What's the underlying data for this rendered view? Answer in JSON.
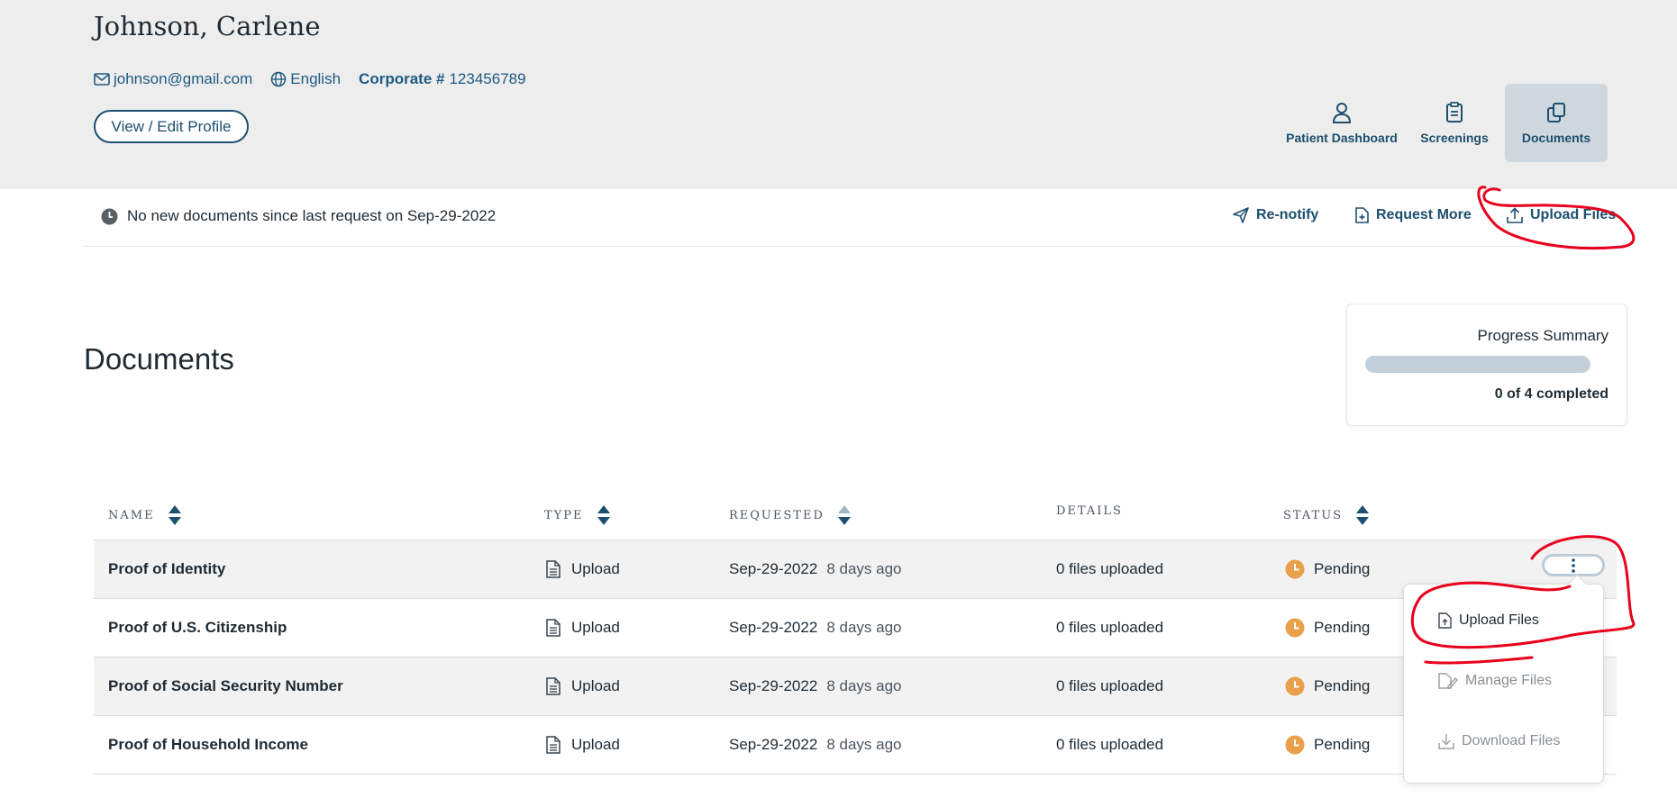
{
  "patient": {
    "name": "Johnson, Carlene",
    "email": "johnson@gmail.com",
    "language": "English",
    "corporate_label": "Corporate #",
    "corporate_number": "123456789",
    "edit_profile_label": "View / Edit Profile"
  },
  "nav_tabs": [
    {
      "label": "Patient Dashboard",
      "icon": "person-icon"
    },
    {
      "label": "Screenings",
      "icon": "clipboard-icon"
    },
    {
      "label": "Documents",
      "icon": "documents-icon",
      "active": true
    }
  ],
  "notice": {
    "text": "No new documents since last request on Sep-29-2022",
    "icon": "clock-icon"
  },
  "actions": {
    "renotify": "Re-notify",
    "request_more": "Request More",
    "upload_files": "Upload Files"
  },
  "page_title": "Documents",
  "progress": {
    "title": "Progress Summary",
    "completed": 0,
    "total": 4,
    "summary": "0 of 4 completed",
    "fraction": 0.0
  },
  "table": {
    "headers": {
      "name": "NAME",
      "type": "TYPE",
      "requested": "REQUESTED",
      "details": "DETAILS",
      "status": "STATUS"
    },
    "rows": [
      {
        "name": "Proof of Identity",
        "type": "Upload",
        "requested": "Sep-29-2022",
        "ago": "8 days ago",
        "details": "0 files uploaded",
        "status": "Pending"
      },
      {
        "name": "Proof of U.S. Citizenship",
        "type": "Upload",
        "requested": "Sep-29-2022",
        "ago": "8 days ago",
        "details": "0 files uploaded",
        "status": "Pending"
      },
      {
        "name": "Proof of Social Security Number",
        "type": "Upload",
        "requested": "Sep-29-2022",
        "ago": "8 days ago",
        "details": "0 files uploaded",
        "status": "Pending"
      },
      {
        "name": "Proof of Household Income",
        "type": "Upload",
        "requested": "Sep-29-2022",
        "ago": "8 days ago",
        "details": "0 files uploaded",
        "status": "Pending"
      }
    ]
  },
  "row_menu": {
    "upload": "Upload Files",
    "manage": "Manage Files",
    "download": "Download Files"
  },
  "colors": {
    "primary": "#1d4f6e",
    "header_bg": "#ededed",
    "active_tab_bg": "#cfd8df",
    "pending": "#e8a04a",
    "annotation": "#e8001c"
  }
}
